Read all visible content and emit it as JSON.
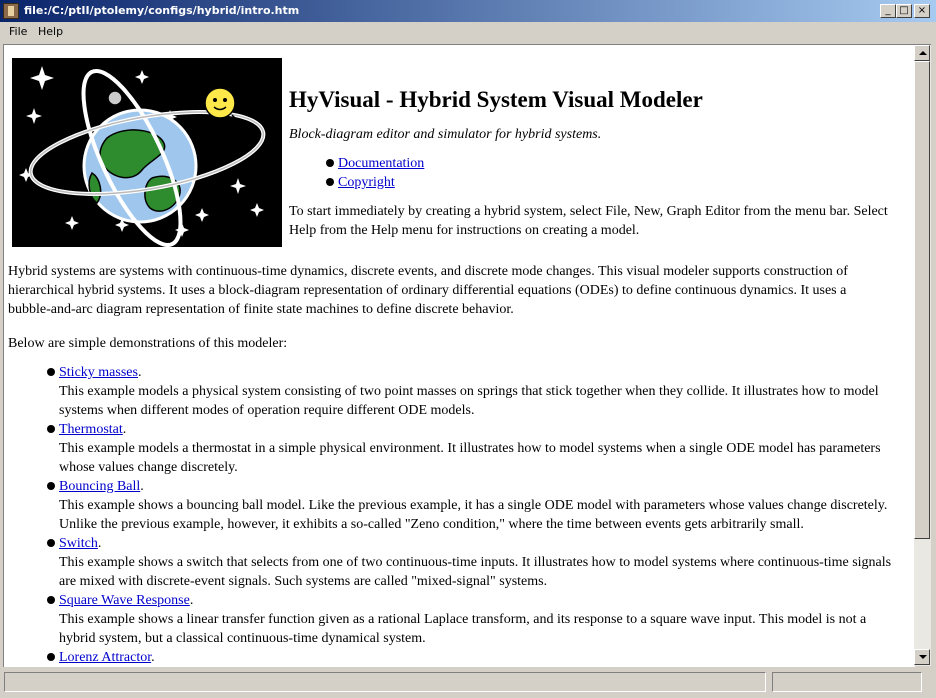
{
  "window": {
    "title": "file:/C:/ptII/ptolemy/configs/hybrid/intro.htm",
    "minimize_glyph": "_",
    "maximize_glyph": "□",
    "close_glyph": "×"
  },
  "menu": [
    "File",
    "Help"
  ],
  "page": {
    "heading": "HyVisual - Hybrid System Visual Modeler",
    "subtitle": "Block-diagram editor and simulator for hybrid systems.",
    "top_links": [
      "Documentation",
      "Copyright"
    ],
    "start_text_lines": [
      "To start immediately by creating a hybrid system, select File, New, Graph Editor from the menu bar. Select",
      "Help from the Help menu for instructions on creating a model."
    ],
    "intro_lines": [
      "Hybrid systems are systems with continuous-time dynamics, discrete events, and discrete mode changes. This visual modeler supports construction of",
      "hierarchical hybrid systems. It uses a block-diagram representation of ordinary differential equations (ODEs) to define continuous dynamics. It uses a",
      "bubble-and-arc diagram representation of finite state machines to define discrete behavior."
    ],
    "demos_intro": "Below are simple demonstrations of this modeler:",
    "demos": [
      {
        "title": "Sticky masses",
        "desc": [
          "This example models a physical system consisting of two point masses on springs that stick together when they collide. It illustrates how to model",
          "systems when different modes of operation require different ODE models."
        ]
      },
      {
        "title": "Thermostat",
        "desc": [
          "This example models a thermostat in a simple physical environment. It illustrates how to model systems when a single ODE model has parameters",
          "whose values change discretely."
        ]
      },
      {
        "title": "Bouncing Ball",
        "desc": [
          "This example shows a bouncing ball model. Like the previous example, it has a single ODE model with parameters whose values change discretely.",
          "Unlike the previous example, however, it exhibits a so-called \"Zeno condition,\" where the time between events gets arbitrarily small."
        ]
      },
      {
        "title": "Switch",
        "desc": [
          "This example shows a switch that selects from one of two continuous-time inputs. It illustrates how to model systems where continuous-time signals",
          "are mixed with discrete-event signals. Such systems are called \"mixed-signal\" systems."
        ]
      },
      {
        "title": "Square Wave Response",
        "desc": [
          "This example shows a linear transfer function given as a rational Laplace transform, and its response to a square wave input. This model is not a",
          "hybrid system, but a classical continuous-time dynamical system."
        ]
      },
      {
        "title": "Lorenz Attractor",
        "desc": []
      }
    ]
  },
  "colors": {
    "link": "#0000cc",
    "titlebar_start": "#0a246a",
    "titlebar_end": "#a6caf0"
  }
}
